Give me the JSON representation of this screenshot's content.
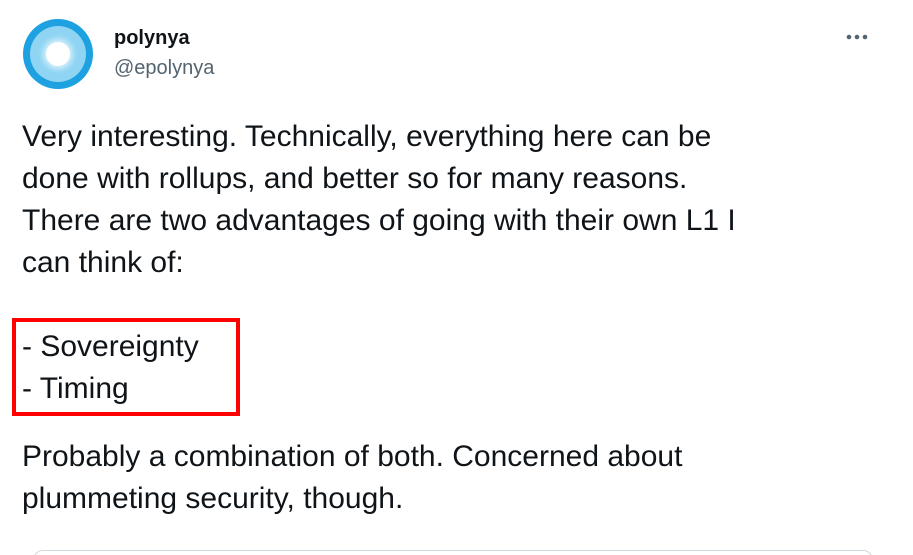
{
  "author": {
    "display_name": "polynya",
    "handle": "@epolynya",
    "avatar_icon": "avatar-circle-icon"
  },
  "more_button": {
    "icon": "more-options-icon",
    "glyph": "•••"
  },
  "tweet": {
    "paragraph_1": "Very interesting. Technically, everything here can be\ndone with rollups, and better so for many reasons.\nThere are two advantages of going with their own L1 I\ncan think of:",
    "list_item_1": "- Sovereignty",
    "list_item_2": "- Timing",
    "paragraph_2": "Probably a combination of both. Concerned about\nplummeting security, though."
  },
  "annotation": {
    "highlight_color": "#ff0000"
  },
  "colors": {
    "avatar_outer": "#1da1e0",
    "avatar_inner": "#8fd4f3",
    "secondary_text": "#536471",
    "primary_text": "#0f1419"
  }
}
